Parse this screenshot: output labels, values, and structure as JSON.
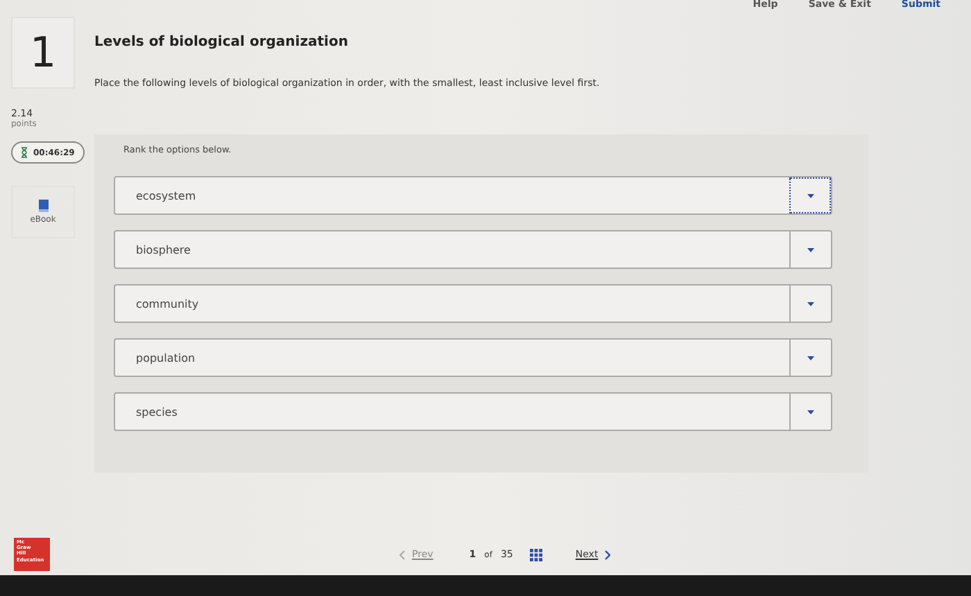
{
  "top_links": [
    {
      "label": "Help",
      "kind": "plain"
    },
    {
      "label": "Save & Exit",
      "kind": "plain"
    },
    {
      "label": "Submit",
      "kind": "primary"
    }
  ],
  "question": {
    "number": "1",
    "points_value": "2.14",
    "points_label": "points",
    "timer": "00:46:29",
    "ebook_label": "eBook",
    "title": "Levels of biological organization",
    "prompt": "Place the following levels of biological organization in order, with the smallest, least inclusive level first."
  },
  "ranking": {
    "instruction": "Rank the options below.",
    "options": [
      {
        "label": "ecosystem",
        "focused": true
      },
      {
        "label": "biosphere",
        "focused": false
      },
      {
        "label": "community",
        "focused": false
      },
      {
        "label": "population",
        "focused": false
      },
      {
        "label": "species",
        "focused": false
      }
    ]
  },
  "footer": {
    "logo_lines": [
      "Mc",
      "Graw",
      "Hill",
      "Education"
    ],
    "prev": "Prev",
    "page_current": "1",
    "page_of": "of",
    "page_total": "35",
    "next": "Next"
  }
}
